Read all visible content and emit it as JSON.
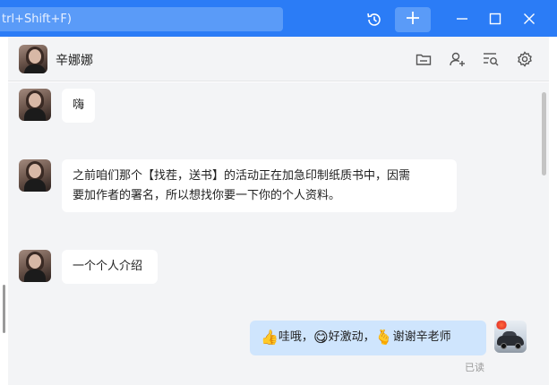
{
  "titlebar": {
    "search_placeholder": "trl+Shift+F)",
    "icons": [
      "history-icon",
      "plus-icon",
      "minimize-icon",
      "maximize-icon",
      "close-icon"
    ],
    "accent": "#2b7cf6"
  },
  "chat": {
    "contact_name": "辛娜娜",
    "header_icons": [
      "folder-icon",
      "add-user-icon",
      "search-history-icon",
      "settings-icon"
    ]
  },
  "messages": [
    {
      "from": "contact",
      "text": "嗨"
    },
    {
      "from": "contact",
      "line1": "之前咱们那个【找茬，送书】的活动正在加急印制纸质书中，因需",
      "line2": "要加作者的署名，所以想找你要一下你的个人资料。"
    },
    {
      "from": "contact",
      "text": "一个个人介绍"
    },
    {
      "from": "me",
      "parts": [
        "👍",
        "哇哦，",
        "😋",
        "好激动，",
        "🫰",
        "谢谢辛老师"
      ],
      "status": "已读"
    }
  ],
  "colors": {
    "my_bubble": "#cfe5fd",
    "their_bubble": "#ffffff",
    "chat_bg": "#f3f4f6"
  }
}
